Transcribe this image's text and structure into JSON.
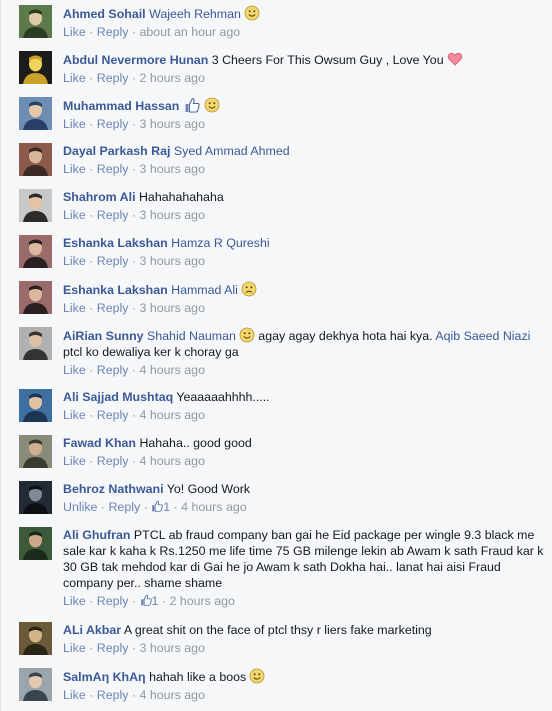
{
  "labels": {
    "like": "Like",
    "unlike": "Unlike",
    "reply": "Reply",
    "sep": "·"
  },
  "comments": [
    {
      "author": "Ahmed Sohail",
      "segments": [
        {
          "t": "mention",
          "v": "Wajeeh Rehman"
        }
      ],
      "emoji": "smile-icon",
      "action": "Like",
      "time": "about an hour ago",
      "likes": ""
    },
    {
      "author": "Abdul Nevermore Hunan",
      "segments": [
        {
          "t": "text",
          "v": "3 Cheers For This Owsum Guy , Love You"
        }
      ],
      "emoji": "heart-icon",
      "action": "Like",
      "time": "2 hours ago",
      "likes": ""
    },
    {
      "author": "Muhammad Hassan",
      "segments": [],
      "emoji": "thumbs-up-smile-icon",
      "action": "Like",
      "time": "3 hours ago",
      "likes": ""
    },
    {
      "author": "Dayal Parkash Raj",
      "segments": [
        {
          "t": "mention",
          "v": "Syed Ammad Ahmed"
        }
      ],
      "emoji": "",
      "action": "Like",
      "time": "3 hours ago",
      "likes": ""
    },
    {
      "author": "Shahrom Ali",
      "segments": [
        {
          "t": "text",
          "v": "Hahahahahaha"
        }
      ],
      "emoji": "",
      "action": "Like",
      "time": "3 hours ago",
      "likes": ""
    },
    {
      "author": "Eshanka Lakshan",
      "segments": [
        {
          "t": "mention",
          "v": "Hamza R Qureshi"
        }
      ],
      "emoji": "",
      "action": "Like",
      "time": "3 hours ago",
      "likes": ""
    },
    {
      "author": "Eshanka Lakshan",
      "segments": [
        {
          "t": "mention",
          "v": "Hammad Ali"
        }
      ],
      "emoji": "frown-icon",
      "action": "Like",
      "time": "3 hours ago",
      "likes": ""
    },
    {
      "author": "AiRian Sunny",
      "segments": [
        {
          "t": "mention",
          "v": "Shahid Nauman"
        },
        {
          "t": "emoji",
          "v": "smile"
        },
        {
          "t": "text",
          "v": " agay agay dekhya hota hai kya. "
        },
        {
          "t": "mention",
          "v": "Aqib Saeed Niazi"
        },
        {
          "t": "text",
          "v": " ptcl ko dewaliya ker k choray ga"
        }
      ],
      "emoji": "",
      "action": "Like",
      "time": "4 hours ago",
      "likes": ""
    },
    {
      "author": "Ali Sajjad Mushtaq",
      "segments": [
        {
          "t": "text",
          "v": "Yeaaaaahhhh....."
        }
      ],
      "emoji": "",
      "action": "Like",
      "time": "4 hours ago",
      "likes": ""
    },
    {
      "author": "Fawad Khan",
      "segments": [
        {
          "t": "text",
          "v": "Hahaha.. good good"
        }
      ],
      "emoji": "",
      "action": "Like",
      "time": "4 hours ago",
      "likes": ""
    },
    {
      "author": "Behroz Nathwani",
      "segments": [
        {
          "t": "text",
          "v": "Yo! Good Work"
        }
      ],
      "emoji": "",
      "action": "Unlike",
      "time": "4 hours ago",
      "likes": "1"
    },
    {
      "author": "Ali Ghufran",
      "segments": [
        {
          "t": "text",
          "v": "PTCL ab fraud company ban gai he Eid package per wingle 9.3 black me sale kar k kaha k Rs.1250 me life time 75 GB milenge lekin ab Awam k sath Fraud kar k 30 GB tak mehdod kar di Gai he jo Awam k sath Dokha hai.. lanat hai aisi Fraud company per.. shame shame"
        }
      ],
      "emoji": "",
      "action": "Like",
      "time": "2 hours ago",
      "likes": "1"
    },
    {
      "author": "ALi Akbar",
      "segments": [
        {
          "t": "text",
          "v": "A great shit on the face of ptcl thsy r liers fake marketing"
        }
      ],
      "emoji": "",
      "action": "Like",
      "time": "3 hours ago",
      "likes": ""
    },
    {
      "author": "SalmAη KhAη",
      "segments": [
        {
          "t": "text",
          "v": "hahah like a boos"
        }
      ],
      "emoji": "smile-icon",
      "action": "Like",
      "time": "4 hours ago",
      "likes": ""
    }
  ]
}
